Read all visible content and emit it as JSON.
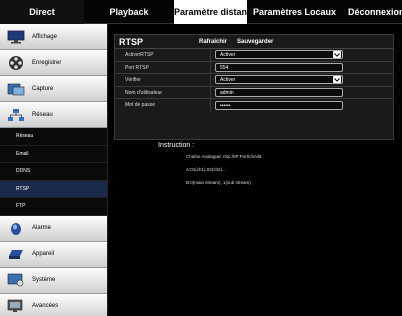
{
  "topnav": {
    "direct": "Direct",
    "playback": "Playback",
    "param": "Paramètre distant",
    "local": "Paramètres Locaux",
    "deco": "Déconnexion"
  },
  "sidebar": {
    "affichage": "Affichage",
    "enregistrer": "Enregistrer",
    "capture": "Capture",
    "reseau": "Réseau",
    "sub": [
      "Réseau",
      "Email",
      "DDNS",
      "RTSP",
      "FTP"
    ],
    "alarme": "Alarme",
    "appareil": "Appareil",
    "systeme": "Système",
    "avancees": "Avancées"
  },
  "panel": {
    "title": "RTSP",
    "refresh": "Rafraîchir",
    "save": "Sauvegarder",
    "rows": {
      "activer_label": "ActiverRTSP",
      "activer_value": "Activer",
      "port_label": "Port RTSP",
      "port_value": "554",
      "verifier_label": "Vérifier",
      "verifier_value": "Activer",
      "user_label": "Nom d'utilisateur",
      "user_value": "admin",
      "pass_label": "Mot de passe",
      "pass_value": "••••••"
    }
  },
  "instruction": {
    "title": "Instruction :",
    "line1": "Chaîne Analogue: rtsp://IP:Port/chA/B",
    "line2": "A:01(ch1),02(ch2)...",
    "line3": "B:0(main stream), 1(sub stream)"
  }
}
